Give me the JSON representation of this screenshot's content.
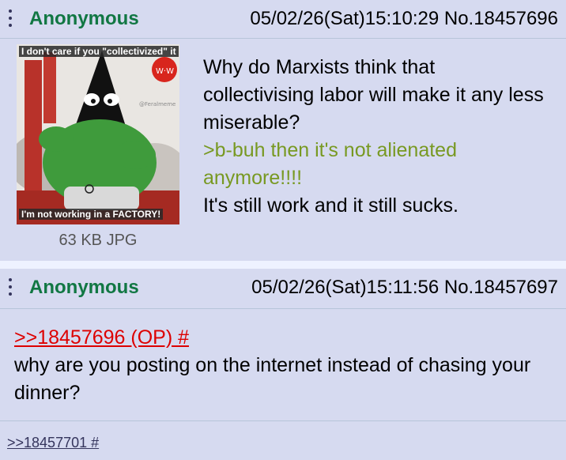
{
  "post1": {
    "name": "Anonymous",
    "meta": "05/02/26(Sat)15:10:29 No.18457696",
    "image_caption_top": "I don't care if you \"collectivized\" it",
    "image_caption_bottom": "I'm not working in a FACTORY!",
    "image_watermark": "@Feralmeme",
    "file_info": "63 KB JPG",
    "lines": [
      {
        "text": "Why do Marxists think that collectivising labor will make it any less miserable?",
        "type": "text"
      },
      {
        "text": ">b-buh then it's not alienated anymore!!!!",
        "type": "greentext"
      },
      {
        "text": "It's still work and it still sucks.",
        "type": "text"
      }
    ]
  },
  "post2": {
    "name": "Anonymous",
    "meta": "05/02/26(Sat)15:11:56 No.18457697",
    "quotelink": ">>18457696 (OP) #",
    "text": "why are you posting on the internet instead of chasing your dinner?"
  },
  "backlink": ">>18457701 #",
  "colors": {
    "post_bg": "#d6daf0",
    "page_bg": "#eef2ff",
    "name": "#117743",
    "greentext": "#789922",
    "quotelink": "#dd0000"
  }
}
